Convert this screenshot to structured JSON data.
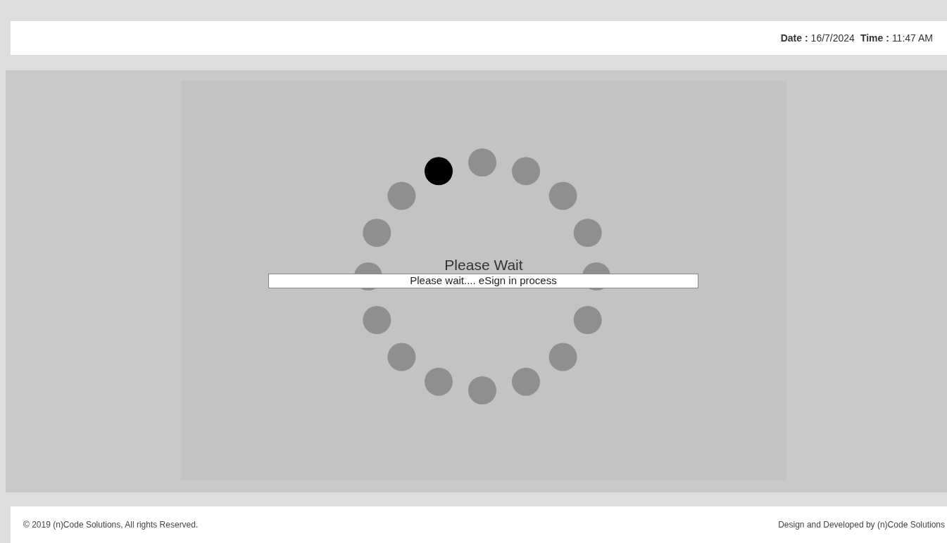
{
  "header": {
    "date_label": "Date :",
    "date": "16/7/2024",
    "time_label": "Time :",
    "time": "11:47 AM"
  },
  "loader": {
    "dots": [
      {
        "active": false
      },
      {
        "active": false
      },
      {
        "active": false
      },
      {
        "active": false
      },
      {
        "active": false
      },
      {
        "active": false
      },
      {
        "active": false
      },
      {
        "active": false
      },
      {
        "active": false
      },
      {
        "active": false
      },
      {
        "active": false
      },
      {
        "active": false
      },
      {
        "active": false
      },
      {
        "active": false
      },
      {
        "active": false
      },
      {
        "active": true
      }
    ],
    "title": "Please Wait",
    "message": "Please wait.... eSign in process"
  },
  "footer": {
    "copyright": "© 2019 (n)Code Solutions, All rights Reserved.",
    "credit": "Design and Developed by (n)Code Solutions"
  }
}
